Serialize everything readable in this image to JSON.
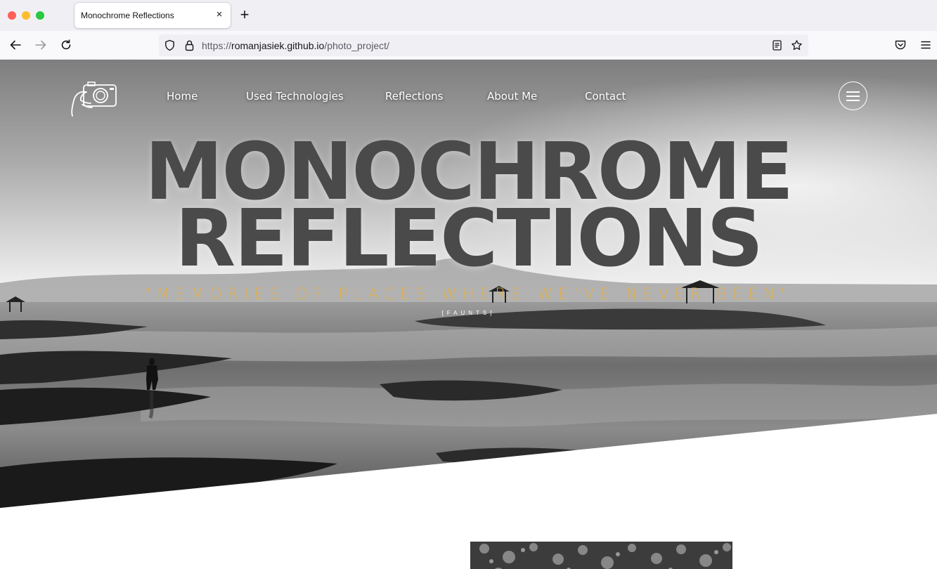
{
  "browser": {
    "tab_title": "Monochrome Reflections",
    "tab_close": "×",
    "new_tab": "+",
    "url_scheme": "https://",
    "url_host": "romanjasiek.github.io",
    "url_path": "/photo_project/"
  },
  "site": {
    "nav": [
      {
        "label": "Home"
      },
      {
        "label": "Used Technologies"
      },
      {
        "label": "Reflections"
      },
      {
        "label": "About Me"
      },
      {
        "label": "Contact"
      }
    ],
    "hero": {
      "title_line1": "MONOCHROME",
      "title_line2": "REFLECTIONS",
      "quote": "\"MEMORIES OF PLACES WHERE WE'VE NEVER BEEN\"",
      "quote_author": "[FAUNTS]"
    }
  },
  "colors": {
    "title": "#4a4a4a",
    "quote": "#e2b04a"
  }
}
